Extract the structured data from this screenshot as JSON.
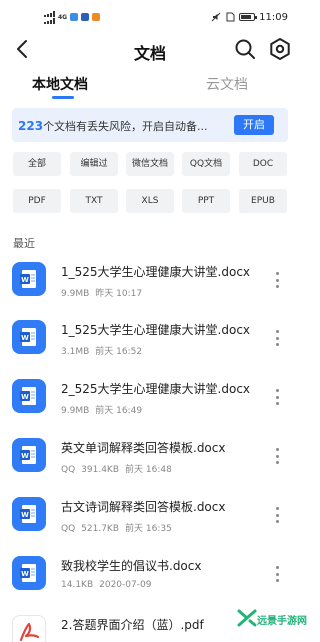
{
  "status_bar": {
    "time": "11:09",
    "network_badge": "4G"
  },
  "header": {
    "title": "文档"
  },
  "tabs": [
    {
      "label": "本地文档",
      "active": true
    },
    {
      "label": "云文档",
      "active": false
    }
  ],
  "banner": {
    "count": "223",
    "text": "个文档有丢失风险，开启自动备...",
    "button_label": "开启"
  },
  "filters": [
    "全部",
    "编辑过",
    "微信文档",
    "QQ文档",
    "DOC",
    "PDF",
    "TXT",
    "XLS",
    "PPT",
    "EPUB"
  ],
  "recent_label": "最近",
  "files": [
    {
      "name": "1_525大学生心理健康大讲堂.docx",
      "source": "",
      "size": "9.9MB",
      "time": "昨天 10:17",
      "type": "word"
    },
    {
      "name": "1_525大学生心理健康大讲堂.docx",
      "source": "",
      "size": "3.1MB",
      "time": "前天 16:52",
      "type": "word"
    },
    {
      "name": "2_525大学生心理健康大讲堂.docx",
      "source": "",
      "size": "9.9MB",
      "time": "前天 16:49",
      "type": "word"
    },
    {
      "name": "英文单词解释类回答模板.docx",
      "source": "QQ",
      "size": "391.4KB",
      "time": "前天 16:48",
      "type": "word"
    },
    {
      "name": "古文诗词解释类回答模板.docx",
      "source": "QQ",
      "size": "521.7KB",
      "time": "前天 16:35",
      "type": "word"
    },
    {
      "name": "致我校学生的倡议书.docx",
      "source": "",
      "size": "14.1KB",
      "time": "2020-07-09",
      "type": "word"
    },
    {
      "name": "2.答题界面介绍（蓝）.pdf",
      "source": "",
      "size": "",
      "time": "",
      "type": "pdf"
    }
  ],
  "icons": {
    "back": "back-arrow-icon",
    "search": "search-icon",
    "settings": "settings-hexagon-icon",
    "word": "word-doc-icon",
    "pdf": "pdf-icon",
    "more": "more-vertical-icon"
  },
  "colors": {
    "accent": "#2c78f6",
    "banner_bg": "#eaf1fd",
    "chip_bg": "#f1f2f4",
    "word_icon": "#2f7cf6",
    "pdf_icon": "#e0443a",
    "watermark": "#23b37a"
  },
  "battery_level": 0.85,
  "watermark": {
    "text": "远景手游网"
  }
}
